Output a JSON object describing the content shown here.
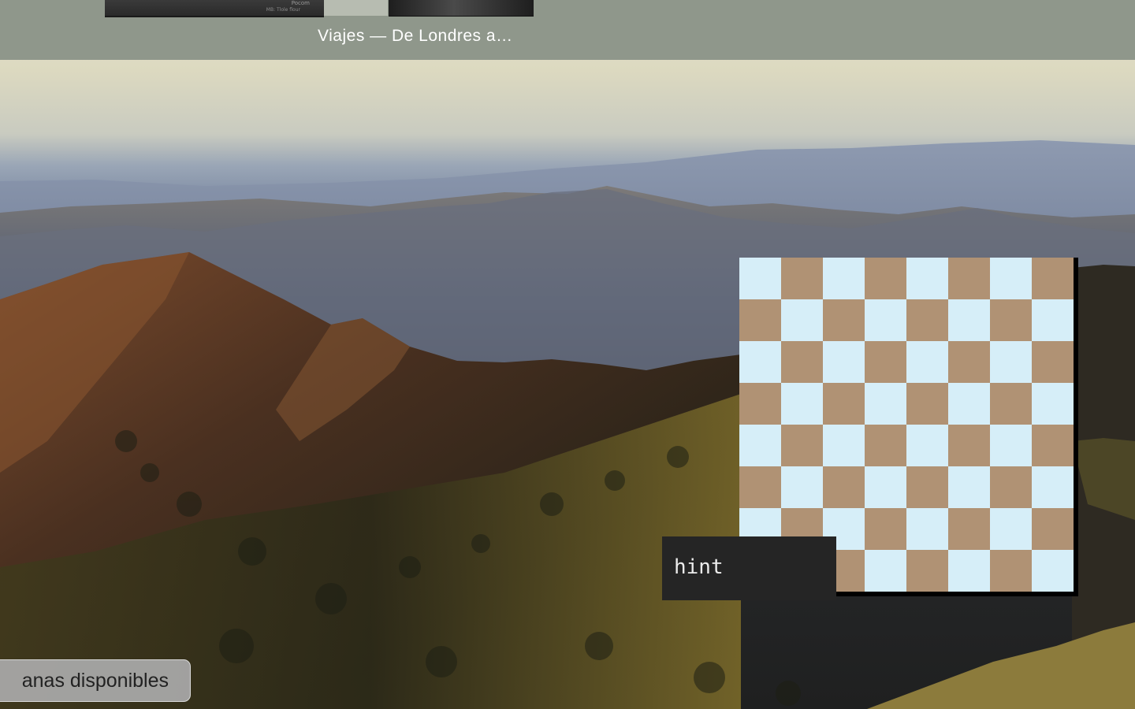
{
  "spaces_bar": {
    "current_space_label": "Viajes — De Londres a…",
    "thumbnail_fragments": [
      "Pocom",
      "MB: Tlole flour"
    ]
  },
  "board": {
    "light_color": "#d6eef8",
    "dark_color": "#b09274",
    "rows": 8,
    "cols": 8
  },
  "hint": {
    "text": "hint"
  },
  "windows_pill": {
    "text": "anas disponibles"
  }
}
